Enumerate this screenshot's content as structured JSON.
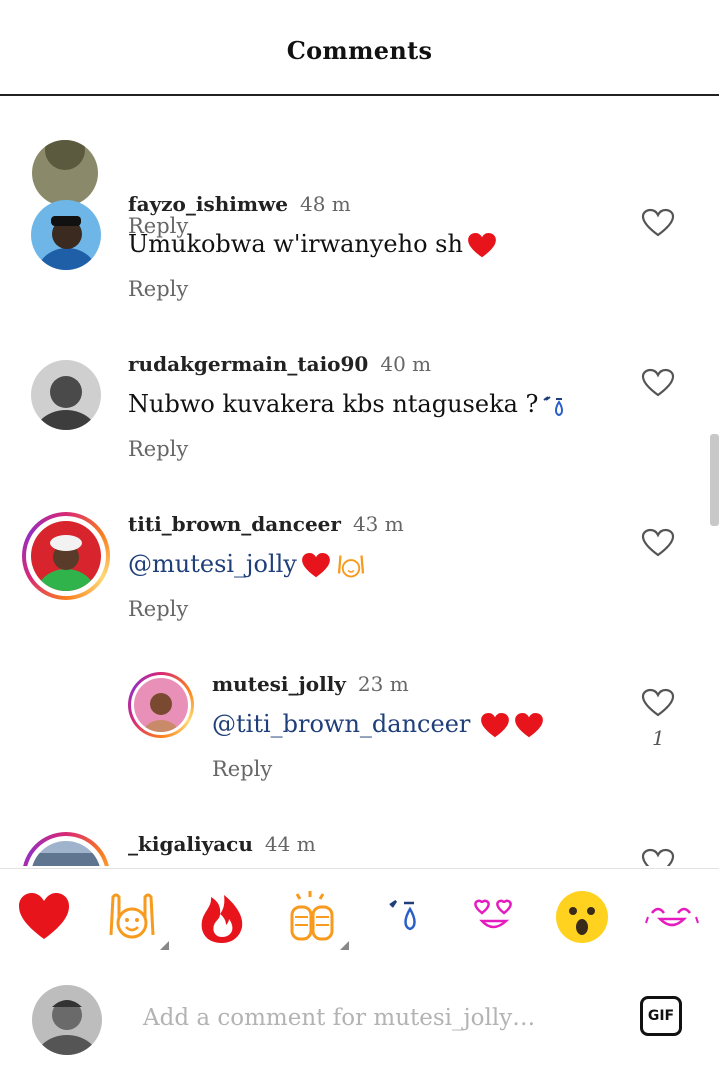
{
  "header": {
    "title": "Comments"
  },
  "comments": [
    {
      "reply_label": "Reply"
    },
    {
      "username": "fayzo_ishimwe",
      "time": "48 m",
      "text": "Umukobwa w'irwanyeho sh",
      "reply_label": "Reply"
    },
    {
      "username": "rudakgermain_taio90",
      "time": "40 m",
      "text": "Nubwo kuvakera kbs ntaguseka ?",
      "reply_label": "Reply"
    },
    {
      "username": "titi_brown_danceer",
      "time": "43 m",
      "text": "@mutesi_jolly",
      "reply_label": "Reply"
    },
    {
      "username": "mutesi_jolly",
      "time": "23 m",
      "text": "@titi_brown_danceer",
      "reply_label": "Reply",
      "like_count": "1"
    },
    {
      "username": "_kigaliyacu",
      "time": "44 m"
    }
  ],
  "emoji_bar": [
    "red-heart",
    "raising-hands",
    "fire",
    "clapping-hands",
    "crying-face",
    "heart-eyes",
    "surprised-face",
    "laughing-face"
  ],
  "composer": {
    "placeholder": "Add a comment for mutesi_jolly…",
    "gif_label": "GIF"
  },
  "colors": {
    "mention": "#1f3f7a",
    "heart": "#e8141c",
    "accent_orange": "#f79a1e",
    "emoji_pink": "#e61bbf"
  }
}
